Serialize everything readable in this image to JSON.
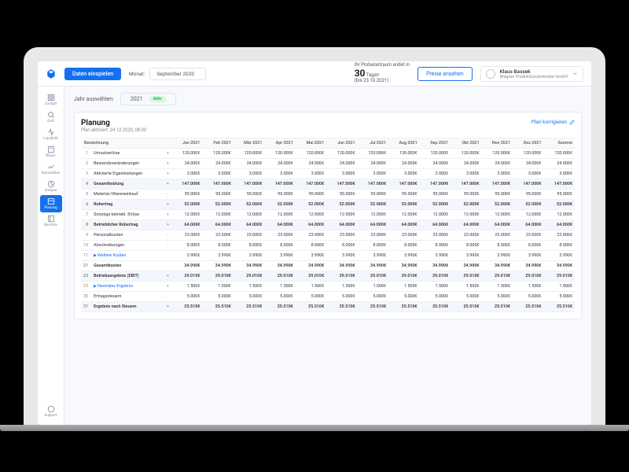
{
  "topbar": {
    "primaryBtn": "Daten einspielen",
    "monthLabel": "Monat:",
    "monthValue": "September 2020",
    "trialLine1": "Ihr Probezeitraum endet in",
    "trialDays": "30",
    "trialLine2": "Tagen",
    "trialDate": "(bis 23.10.2021)",
    "pricesBtn": "Preise ansehen",
    "userName": "Klaus Bassek",
    "userCompany": "Wagner Produktionsbetriebe GmbH"
  },
  "sidebar": {
    "items": [
      "Cockpit",
      "GuV",
      "Liquidität",
      "Bilanz",
      "Kennzahlen",
      "Analyse",
      "Planung",
      "Berichte"
    ],
    "support": "Support",
    "activeIndex": 6
  },
  "yearSelector": {
    "label": "Jahr auswählen:",
    "value": "2021",
    "badge": "Aktiv"
  },
  "panel": {
    "title": "Planung",
    "subtitle": "Plan aktiviert: 24.12.2020, 08:30",
    "action": "Plan korrigieren"
  },
  "table": {
    "headerFirst": "Bezeichnung",
    "months": [
      "Jan 2021",
      "Feb 2021",
      "Mär 2021",
      "Apr 2021",
      "Mai 2021",
      "Jun 2021",
      "Jul 2021",
      "Aug 2021",
      "Sep 2021",
      "Okt 2021",
      "Nov 2021",
      "Dez 2021",
      "Summe"
    ],
    "rows": [
      {
        "n": "1",
        "label": "Umsatzerlöse",
        "op": "+",
        "val": "120.000€",
        "sum": "120.000€"
      },
      {
        "n": "2",
        "label": "Bestandsveränderungen",
        "op": "+",
        "val": "24.000€",
        "sum": "24.000€"
      },
      {
        "n": "3",
        "label": "Aktivierte Eigenleistungen",
        "op": "+",
        "val": "3.000€",
        "sum": "3.000€"
      },
      {
        "n": "4",
        "label": "Gesamtleistung",
        "op": "=",
        "val": "147.000€",
        "sum": "147.000€",
        "bold": true
      },
      {
        "n": "5",
        "label": "Material-/Wareneinkauf",
        "op": "-",
        "val": "95.000€",
        "sum": "95.000€"
      },
      {
        "n": "6",
        "label": "Rohertrag",
        "op": "=",
        "val": "52.000€",
        "sum": "52.000€",
        "bold": true
      },
      {
        "n": "7",
        "label": "Sonstige betriebl. Erlöse",
        "op": "+",
        "val": "12.000€",
        "sum": "12.000€"
      },
      {
        "n": "8",
        "label": "Betrieblicher Rohertrag",
        "op": "=",
        "val": "64.000€",
        "sum": "64.000€",
        "bold": true
      },
      {
        "n": "9",
        "label": "Personalkosten",
        "op": "-",
        "val": "23.000€",
        "sum": "23.000€"
      },
      {
        "n": "10",
        "label": "Abschreibungen",
        "op": "-",
        "val": "8.000€",
        "sum": "8.000€"
      },
      {
        "n": "11",
        "label": "Weitere Kosten",
        "op": "",
        "val": "3.990€",
        "sum": "3.990€",
        "link": true,
        "exp": true
      },
      {
        "n": "21",
        "label": "Gesamtkosten",
        "op": "",
        "val": "34.990€",
        "sum": "34.990€",
        "sum2": true
      },
      {
        "n": "22",
        "label": "Betriebsergebnis (EBIT)",
        "op": "=",
        "val": "29.010€",
        "sum": "29.010€",
        "bold": true
      },
      {
        "n": "23",
        "label": "Neutrales Ergebnis",
        "op": "+",
        "val": "1.500€",
        "sum": "1.500€",
        "link": true,
        "exp": true
      },
      {
        "n": "30",
        "label": "Ertragssteuern",
        "op": "-",
        "val": "5.000€",
        "sum": "5.000€"
      },
      {
        "n": "31",
        "label": "Ergebnis nach Steuern",
        "op": "=",
        "val": "25.510€",
        "sum": "25.510€",
        "bold": true
      }
    ]
  }
}
